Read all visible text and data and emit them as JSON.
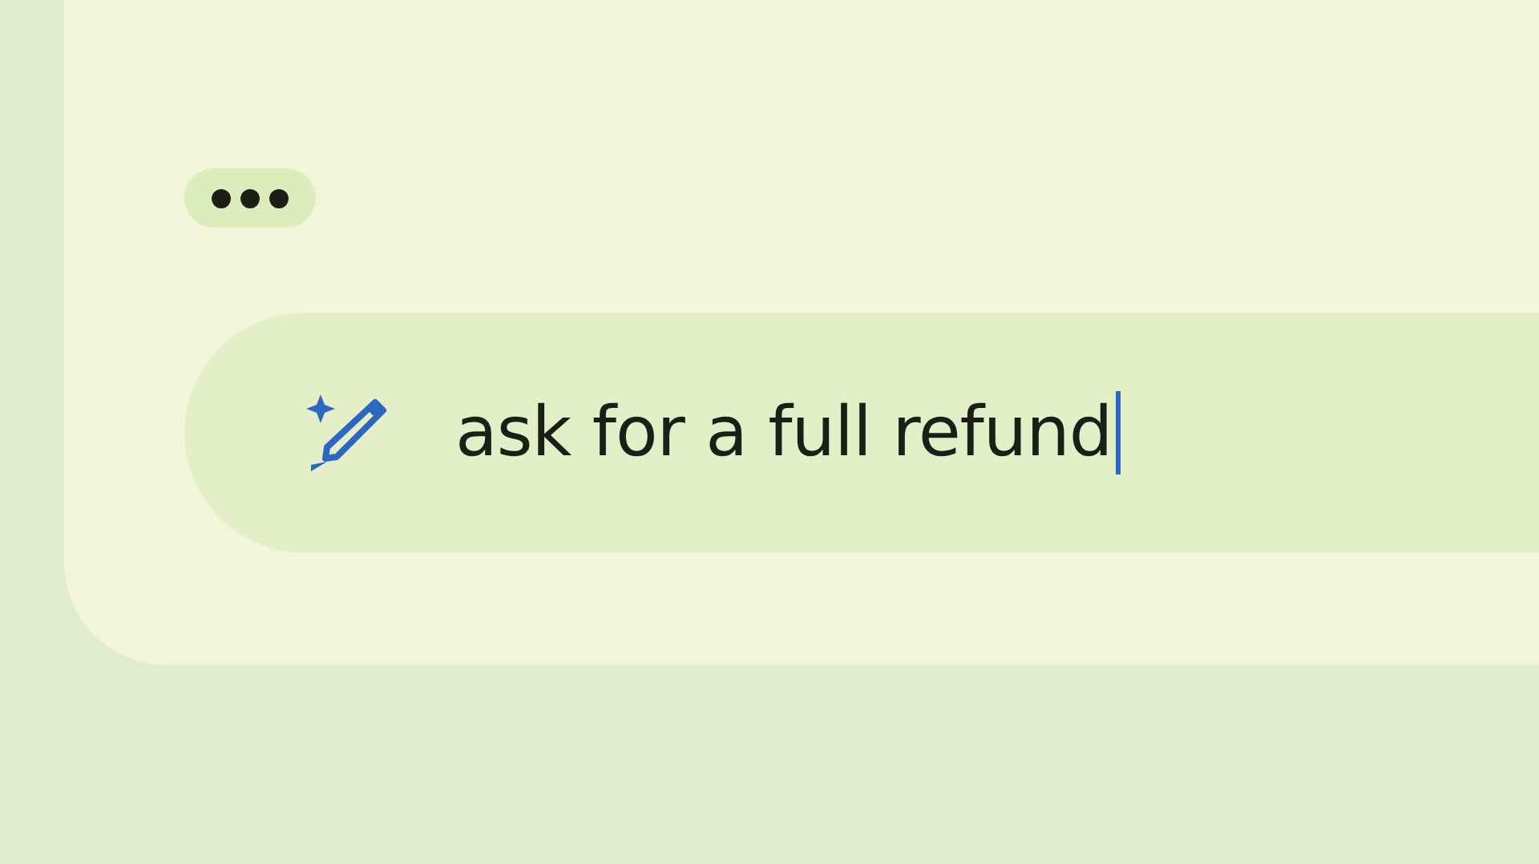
{
  "prompt": {
    "value": "ask for a full refund",
    "focused": true
  }
}
